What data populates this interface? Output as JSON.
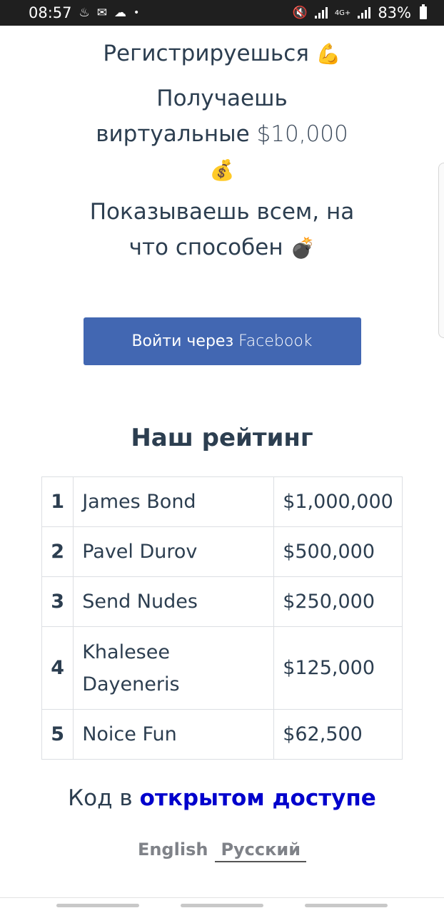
{
  "status_bar": {
    "time": "08:57",
    "left_icons": [
      "steam-notification-icon",
      "mail-icon",
      "weather-icon"
    ],
    "dot": "•",
    "network": "4G+",
    "battery_text": "83%"
  },
  "intro": {
    "line1": "Регистрируешься",
    "line1_emoji": "💪",
    "line2": "Получаешь",
    "line3_prefix": "виртуальные",
    "line3_amount": "$10,000",
    "line4_emoji": "💰",
    "line5": "Показываешь всем, на",
    "line6": "что способен",
    "line6_emoji": "💣"
  },
  "login_button": {
    "label_prefix": "Войти через",
    "label_brand": "Facebook",
    "color": "#4267b2"
  },
  "rating": {
    "title": "Наш рейтинг",
    "rows": [
      {
        "rank": "1",
        "name": "James Bond",
        "score": "$1,000,000"
      },
      {
        "rank": "2",
        "name": "Pavel Durov",
        "score": "$500,000"
      },
      {
        "rank": "3",
        "name": "Send Nudes",
        "score": "$250,000"
      },
      {
        "rank": "4",
        "name": "Khalesee Dayeneris",
        "score": "$125,000"
      },
      {
        "rank": "5",
        "name": "Noice Fun",
        "score": "$62,500"
      }
    ]
  },
  "footer": {
    "code_prefix": "Код в",
    "code_link": "открытом доступе",
    "link_color": "#0000cc",
    "languages": [
      "English",
      "Русский"
    ],
    "active_language": "Русский"
  }
}
